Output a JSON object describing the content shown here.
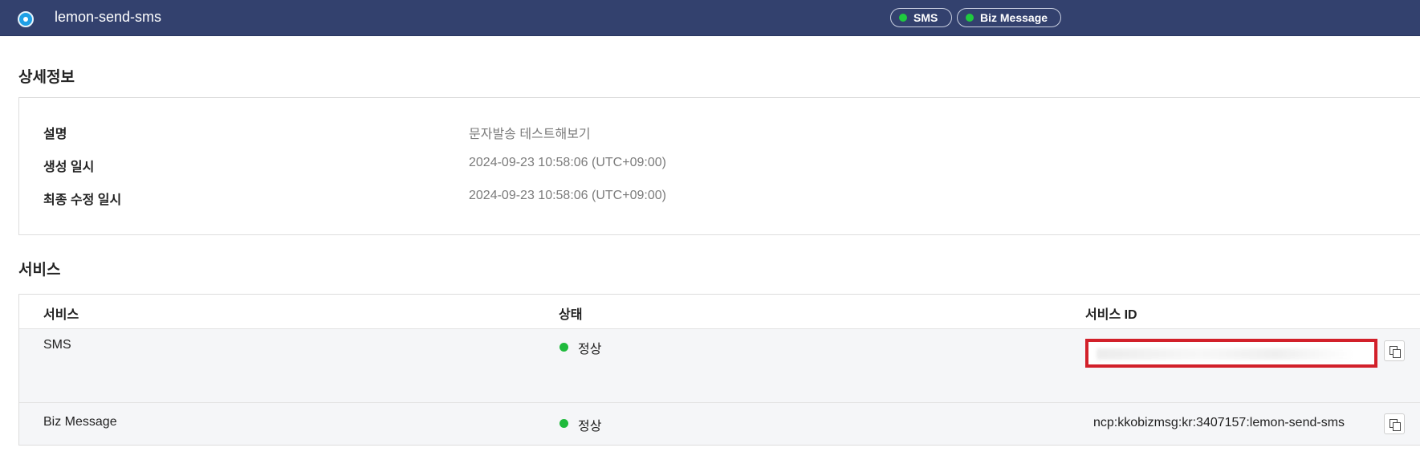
{
  "header": {
    "title": "lemon-send-sms",
    "badges": [
      {
        "label": "SMS",
        "status_color": "#1fca3f"
      },
      {
        "label": "Biz Message",
        "status_color": "#1fca3f"
      }
    ],
    "bar_color": "#33416e"
  },
  "details": {
    "section_title": "상세정보",
    "rows": [
      {
        "label": "설명",
        "value": "문자발송 테스트해보기"
      },
      {
        "label": "생성 일시",
        "value": "2024-09-23 10:58:06 (UTC+09:00)"
      },
      {
        "label": "최종 수정 일시",
        "value": "2024-09-23 10:58:06 (UTC+09:00)"
      }
    ]
  },
  "services": {
    "section_title": "서비스",
    "columns": [
      "서비스",
      "상태",
      "서비스 ID"
    ],
    "rows": [
      {
        "service": "SMS",
        "status": "정상",
        "service_id": "",
        "service_id_redacted": true
      },
      {
        "service": "Biz Message",
        "status": "정상",
        "service_id": "ncp:kkobizmsg:kr:3407157:lemon-send-sms",
        "service_id_redacted": false
      }
    ],
    "status_color": "#1fba3c",
    "highlight_color": "#d2202a"
  }
}
